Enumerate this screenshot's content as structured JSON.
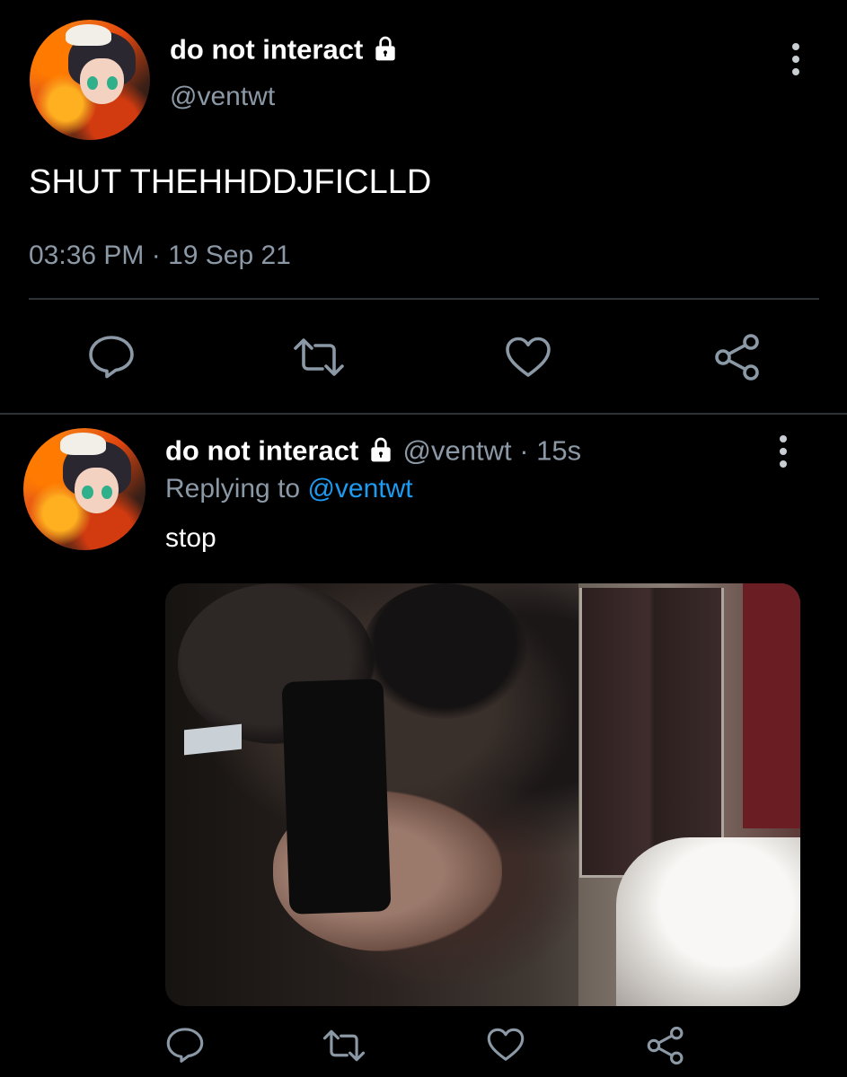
{
  "main_tweet": {
    "display_name": "do not interact",
    "handle": "@ventwt",
    "text": "SHUT THEHHDDJFICLLD",
    "timestamp": "03:36 PM · 19 Sep 21",
    "icons": {
      "lock": "lock-icon",
      "more": "more-vertical-icon",
      "reply": "reply-icon",
      "retweet": "retweet-icon",
      "like": "heart-icon",
      "share": "share-icon"
    }
  },
  "reply_tweet": {
    "display_name": "do not interact",
    "handle_time": "@ventwt · 15s",
    "replying_prefix": "Replying to",
    "replying_to": "@ventwt",
    "text": "stop"
  },
  "colors": {
    "background": "#000000",
    "text": "#ffffff",
    "secondary": "#8b98a5",
    "link": "#1d9bf0",
    "divider": "#2f3336",
    "icon": "#8b98a5"
  }
}
